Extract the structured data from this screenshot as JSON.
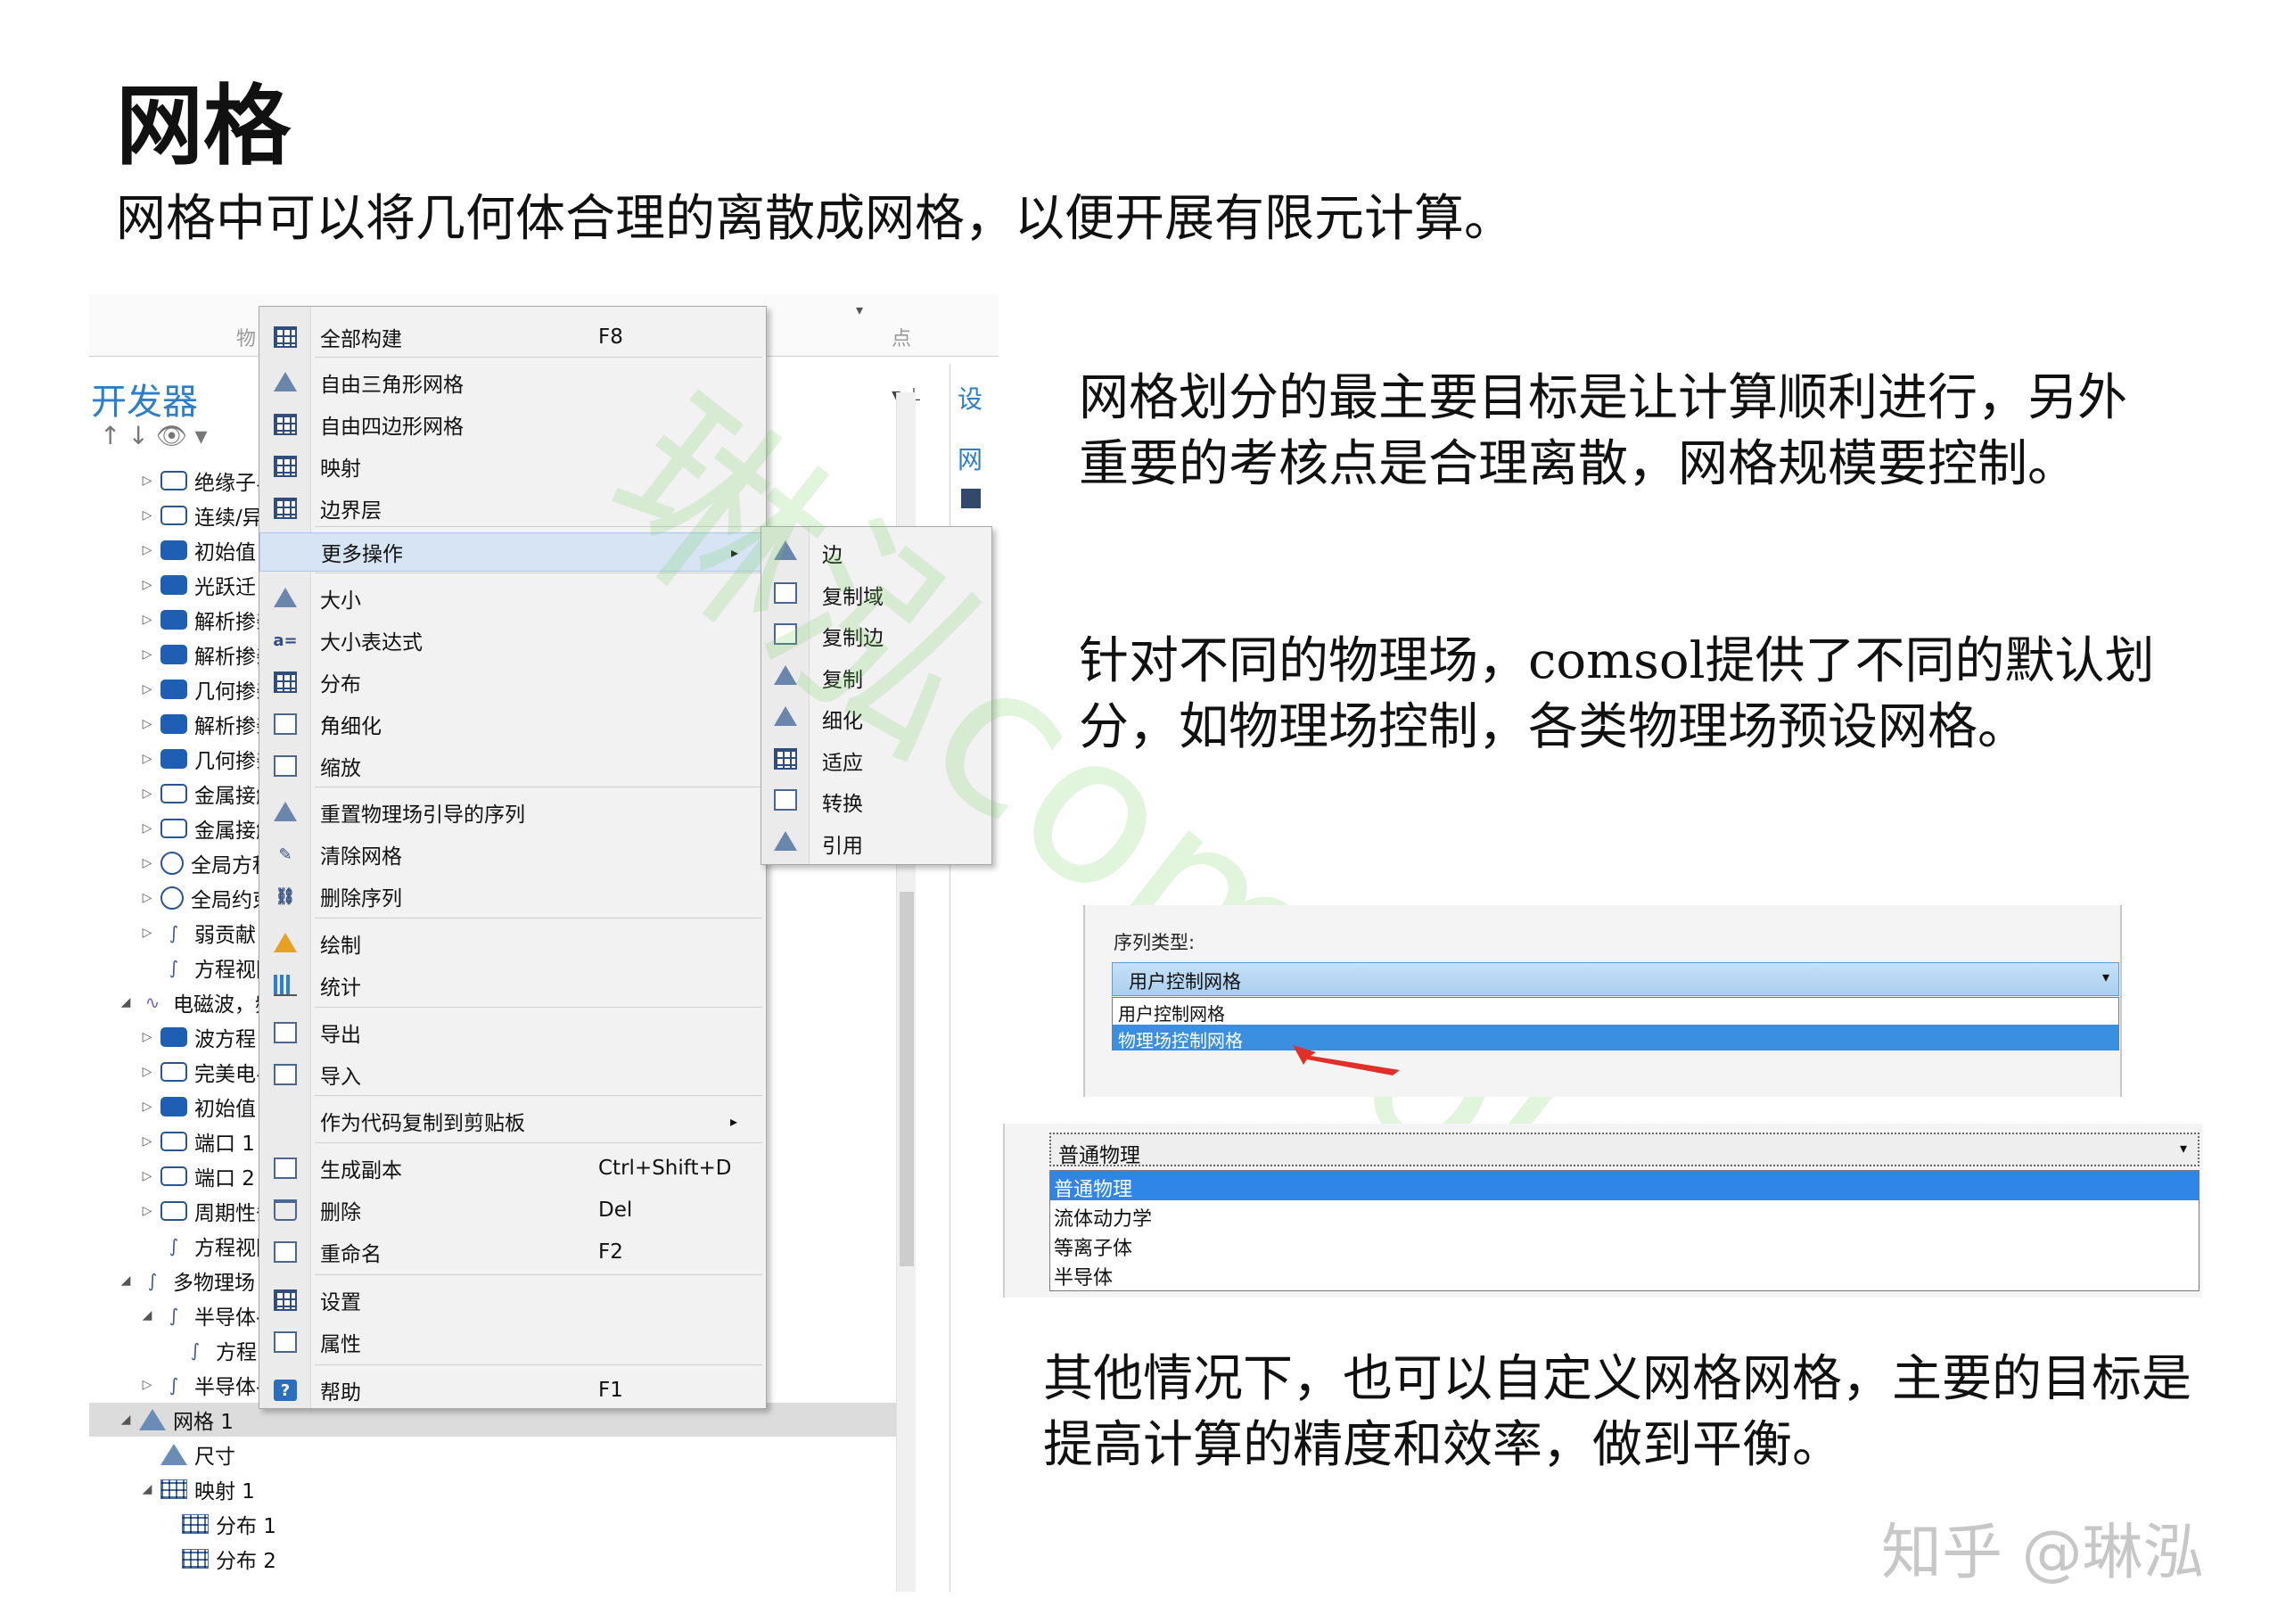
{
  "title": "网格",
  "subtitle": "网格中可以将几何体合理的离散成网格，以便开展有限元计算。",
  "paragraphs": {
    "p1": "网格划分的最主要目标是让计算顺利进行，另外重要的考核点是合理离散，网格规模要控制。",
    "p2": "针对不同的物理场，comsol提供了不同的默认划分，如物理场控制，各类物理场预设网格。",
    "p3": "其他情况下，也可以自定义网格网格，主要的目标是提高计算的精度和效率，做到平衡。"
  },
  "left_screenshot": {
    "ribbon_labels": [
      "物",
      "点"
    ],
    "developer_title": "开发器",
    "side_tabs": [
      "设",
      "网"
    ],
    "tree_items": [
      {
        "label": "绝缘子界",
        "icon": "outline"
      },
      {
        "label": "连续/异",
        "icon": "outline"
      },
      {
        "label": "初始值",
        "icon": "fill"
      },
      {
        "label": "光跃迁",
        "icon": "fill"
      },
      {
        "label": "解析掺杂",
        "icon": "fill"
      },
      {
        "label": "解析掺杂",
        "icon": "fill"
      },
      {
        "label": "几何掺杂",
        "icon": "fill"
      },
      {
        "label": "解析掺杂",
        "icon": "fill"
      },
      {
        "label": "几何掺杂",
        "icon": "fill"
      },
      {
        "label": "金属接触",
        "icon": "outline"
      },
      {
        "label": "金属接触",
        "icon": "outline"
      },
      {
        "label": "全局方程",
        "icon": "circle"
      },
      {
        "label": "全局约束",
        "icon": "circle"
      },
      {
        "label": "弱贡献",
        "icon": "sym"
      },
      {
        "label": "方程视图",
        "icon": "sym"
      },
      {
        "label": "电磁波，频",
        "icon": "wave"
      },
      {
        "label": "波方程",
        "icon": "fill"
      },
      {
        "label": "完美电导",
        "icon": "outline"
      },
      {
        "label": "初始值",
        "icon": "fill"
      },
      {
        "label": "端口 1",
        "icon": "outline"
      },
      {
        "label": "端口 2",
        "icon": "outline"
      },
      {
        "label": "周期性条",
        "icon": "outline"
      },
      {
        "label": "方程视图",
        "icon": "sym"
      },
      {
        "label": "多物理场",
        "icon": "sym"
      },
      {
        "label": "半导体-",
        "icon": "sym"
      },
      {
        "label": "方程",
        "icon": "sym"
      },
      {
        "label": "半导体-",
        "icon": "sym"
      },
      {
        "label": "网格 1",
        "icon": "tri"
      },
      {
        "label": "尺寸",
        "icon": "tri"
      },
      {
        "label": "映射 1",
        "icon": "grid"
      },
      {
        "label": "分布 1",
        "icon": "grid"
      },
      {
        "label": "分布 2",
        "icon": "grid"
      }
    ],
    "context_menu": [
      {
        "label": "全部构建",
        "shortcut": "F8",
        "icon": "build-all-icon"
      },
      {
        "label": "自由三角形网格",
        "shortcut": "",
        "icon": "free-triangular-icon"
      },
      {
        "label": "自由四边形网格",
        "shortcut": "",
        "icon": "free-quad-icon"
      },
      {
        "label": "映射",
        "shortcut": "",
        "icon": "mapped-icon"
      },
      {
        "label": "边界层",
        "shortcut": "",
        "icon": "boundary-layer-icon"
      },
      {
        "label": "更多操作",
        "shortcut": "",
        "icon": "",
        "arrow": "▸"
      },
      {
        "label": "大小",
        "shortcut": "",
        "icon": "size-icon"
      },
      {
        "label": "大小表达式",
        "shortcut": "",
        "icon": "size-expression-icon"
      },
      {
        "label": "分布",
        "shortcut": "",
        "icon": "distribution-icon"
      },
      {
        "label": "角细化",
        "shortcut": "",
        "icon": "corner-refinement-icon"
      },
      {
        "label": "缩放",
        "shortcut": "",
        "icon": "scale-icon"
      },
      {
        "label": "重置物理场引导的序列",
        "shortcut": "",
        "icon": "reset-sequence-icon"
      },
      {
        "label": "清除网格",
        "shortcut": "",
        "icon": "clear-mesh-icon"
      },
      {
        "label": "删除序列",
        "shortcut": "",
        "icon": "delete-sequence-icon"
      },
      {
        "label": "绘制",
        "shortcut": "",
        "icon": "plot-icon"
      },
      {
        "label": "统计",
        "shortcut": "",
        "icon": "statistics-icon"
      },
      {
        "label": "导出",
        "shortcut": "",
        "icon": "export-icon"
      },
      {
        "label": "导入",
        "shortcut": "",
        "icon": "import-icon"
      },
      {
        "label": "作为代码复制到剪贴板",
        "shortcut": "",
        "icon": "",
        "arrow": "▸"
      },
      {
        "label": "生成副本",
        "shortcut": "Ctrl+Shift+D",
        "icon": "duplicate-icon"
      },
      {
        "label": "删除",
        "shortcut": "Del",
        "icon": "delete-icon"
      },
      {
        "label": "重命名",
        "shortcut": "F2",
        "icon": "rename-icon"
      },
      {
        "label": "设置",
        "shortcut": "",
        "icon": "settings-icon"
      },
      {
        "label": "属性",
        "shortcut": "",
        "icon": "properties-icon"
      },
      {
        "label": "帮助",
        "shortcut": "F1",
        "icon": "help-icon"
      }
    ],
    "submenu": [
      "边",
      "复制域",
      "复制边",
      "复制",
      "细化",
      "适应",
      "转换",
      "引用"
    ]
  },
  "dropdown1": {
    "label": "序列类型:",
    "selected": "用户控制网格",
    "options": [
      "用户控制网格",
      "物理场控制网格"
    ]
  },
  "dropdown2": {
    "selected": "普通物理",
    "options": [
      "普通物理",
      "流体动力学",
      "等离子体",
      "半导体"
    ]
  },
  "watermark": "琳泓comsol",
  "credit": "知乎 @琳泓"
}
